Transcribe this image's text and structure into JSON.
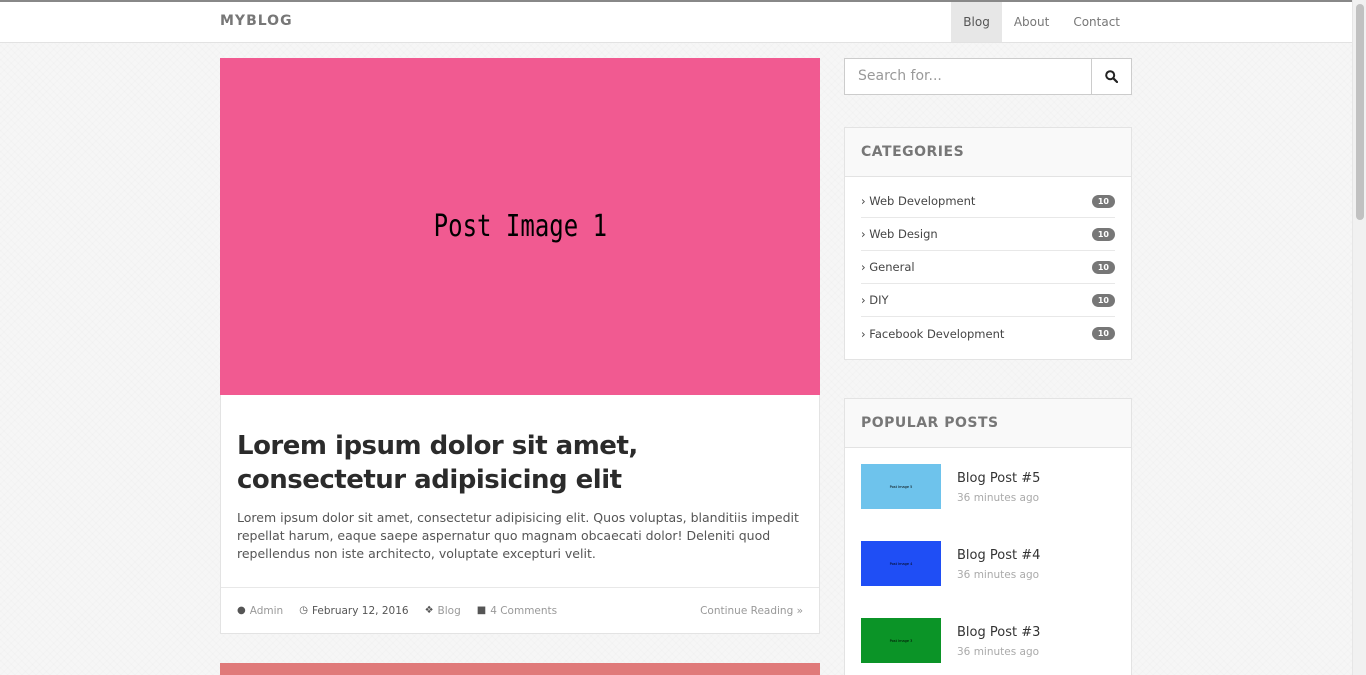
{
  "navbar": {
    "brand": "MYBLOG",
    "links": [
      {
        "label": "Blog",
        "active": true
      },
      {
        "label": "About",
        "active": false
      },
      {
        "label": "Contact",
        "active": false
      }
    ]
  },
  "post": {
    "image_label": "Post Image 1",
    "image_color": "#f15a91",
    "title": "Lorem ipsum dolor sit amet, consectetur adipisicing elit",
    "excerpt": "Lorem ipsum dolor sit amet, consectetur adipisicing elit. Quos voluptas, blanditiis impedit repellat harum, eaque saepe aspernatur quo magnam obcaecati dolor! Deleniti quod repellendus non iste architecto, voluptate excepturi velit.",
    "author": "Admin",
    "date": "February 12, 2016",
    "category": "Blog",
    "comments": "4 Comments",
    "continue": "Continue Reading »"
  },
  "next_post": {
    "image_color": "#e07a7a"
  },
  "search": {
    "placeholder": "Search for..."
  },
  "categories": {
    "heading": "CATEGORIES",
    "items": [
      {
        "label": "Web Development",
        "count": "10"
      },
      {
        "label": "Web Design",
        "count": "10"
      },
      {
        "label": "General",
        "count": "10"
      },
      {
        "label": "DIY",
        "count": "10"
      },
      {
        "label": "Facebook Development",
        "count": "10"
      }
    ]
  },
  "popular": {
    "heading": "POPULAR POSTS",
    "items": [
      {
        "title": "Blog Post #5",
        "time": "36 minutes ago",
        "thumb_label": "Post Image 5",
        "color": "#6ec3ec"
      },
      {
        "title": "Blog Post #4",
        "time": "36 minutes ago",
        "thumb_label": "Post Image 4",
        "color": "#1f4ef5"
      },
      {
        "title": "Blog Post #3",
        "time": "36 minutes ago",
        "thumb_label": "Post Image 3",
        "color": "#0b9427"
      }
    ]
  }
}
